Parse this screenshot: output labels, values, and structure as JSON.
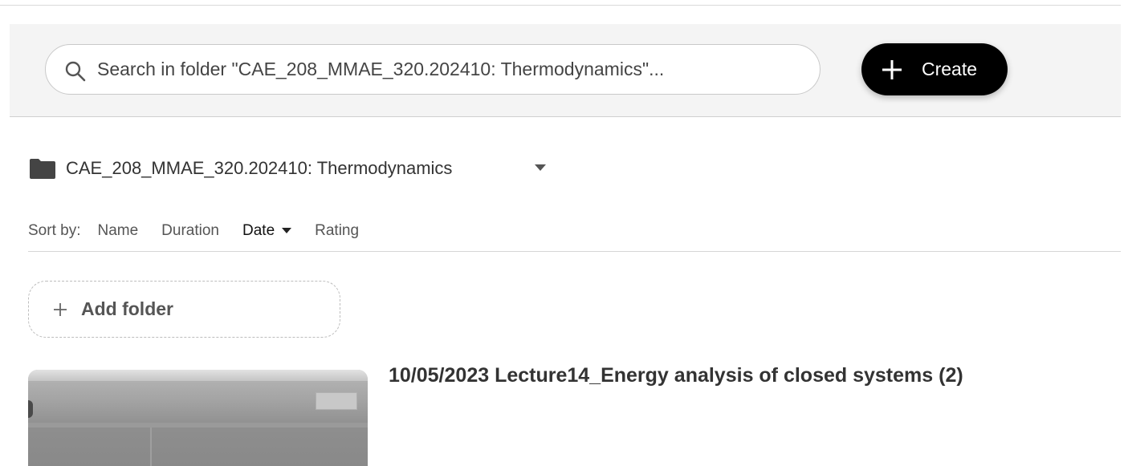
{
  "search": {
    "placeholder": "Search in folder \"CAE_208_MMAE_320.202410: Thermodynamics\"...",
    "icon": "search-icon"
  },
  "toolbar": {
    "create_label": "Create",
    "create_icon": "plus-icon"
  },
  "folder": {
    "name": "CAE_208_MMAE_320.202410: Thermodynamics",
    "icon": "folder-icon"
  },
  "sort": {
    "label": "Sort by:",
    "options": [
      "Name",
      "Duration",
      "Date",
      "Rating"
    ],
    "active": "Date"
  },
  "add_folder": {
    "label": "Add folder"
  },
  "videos": [
    {
      "title": "10/05/2023 Lecture14_Energy analysis of closed systems (2)"
    }
  ],
  "colors": {
    "create_button_bg": "#000000",
    "search_band_bg": "#f4f4f4"
  }
}
